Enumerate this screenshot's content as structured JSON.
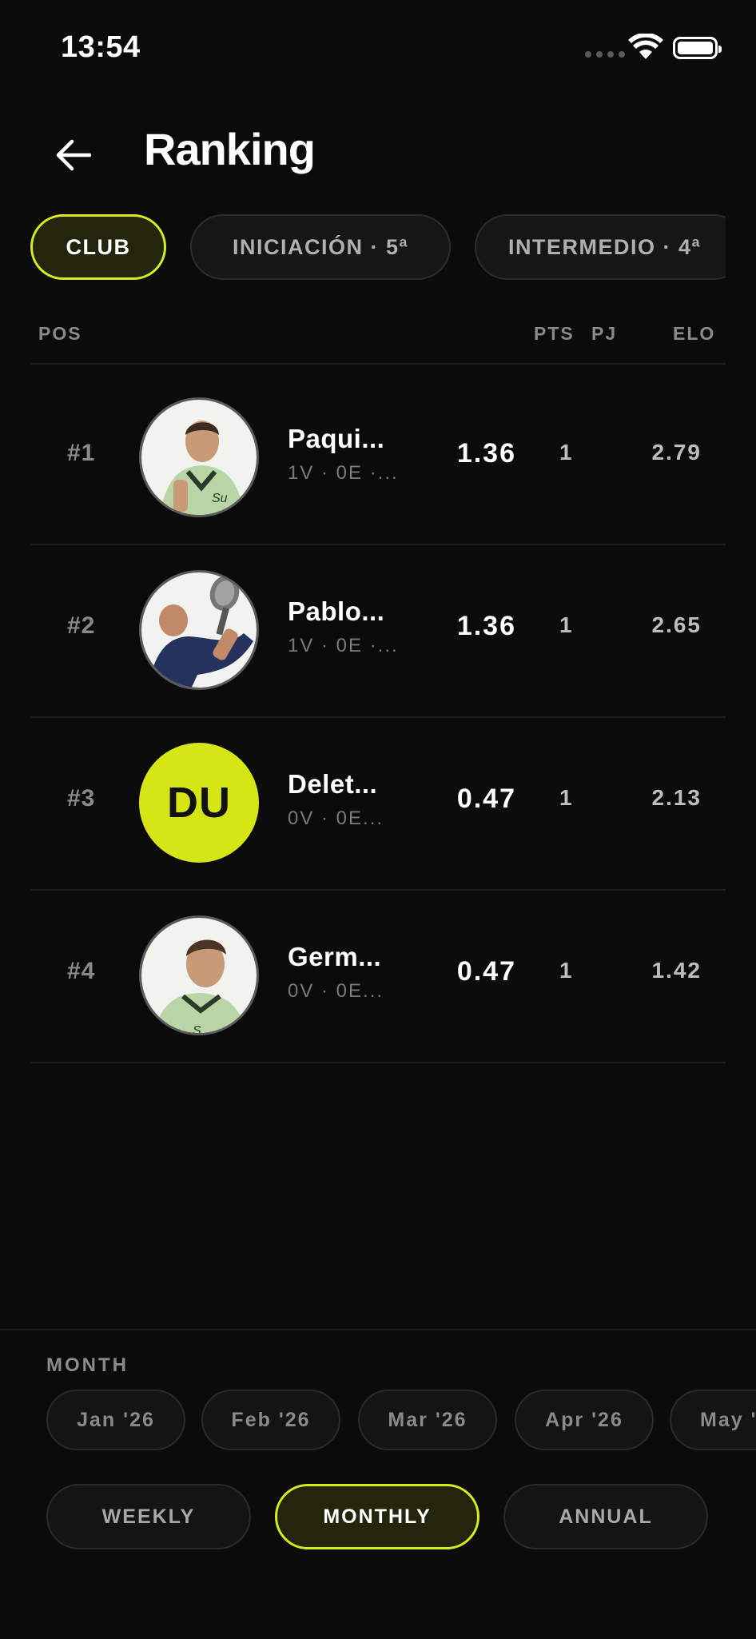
{
  "status": {
    "time": "13:54"
  },
  "header": {
    "title": "Ranking"
  },
  "tabs": [
    {
      "label": "CLUB",
      "active": true
    },
    {
      "label": "INICIACIÓN · 5ª",
      "active": false
    },
    {
      "label": "INTERMEDIO · 4ª",
      "active": false
    }
  ],
  "columns": {
    "pos": "POS",
    "pts": "PTS",
    "pj": "PJ",
    "elo": "ELO"
  },
  "rows": [
    {
      "pos": "#1",
      "name": "Paqui...",
      "sub": "1V · 0E ·...",
      "pts": "1.36",
      "pj": "1",
      "elo": "2.79",
      "avatar": "photo"
    },
    {
      "pos": "#2",
      "name": "Pablo...",
      "sub": "1V · 0E ·...",
      "pts": "1.36",
      "pj": "1",
      "elo": "2.65",
      "avatar": "photo"
    },
    {
      "pos": "#3",
      "name": "Delet...",
      "sub": "0V · 0E...",
      "pts": "0.47",
      "pj": "1",
      "elo": "2.13",
      "avatar": "initials",
      "initials": "DU"
    },
    {
      "pos": "#4",
      "name": "Germ...",
      "sub": "0V · 0E...",
      "pts": "0.47",
      "pj": "1",
      "elo": "1.42",
      "avatar": "photo"
    }
  ],
  "month_section": {
    "label": "MONTH",
    "months": [
      "Jan '26",
      "Feb '26",
      "Mar '26",
      "Apr '26",
      "May '"
    ]
  },
  "periods": [
    {
      "label": "WEEKLY",
      "active": false
    },
    {
      "label": "MONTHLY",
      "active": true
    },
    {
      "label": "ANNUAL",
      "active": false
    }
  ],
  "colors": {
    "accent": "#d8ec1a",
    "background": "#0b0b0b",
    "avatar_initials_bg": "#d6e515"
  }
}
